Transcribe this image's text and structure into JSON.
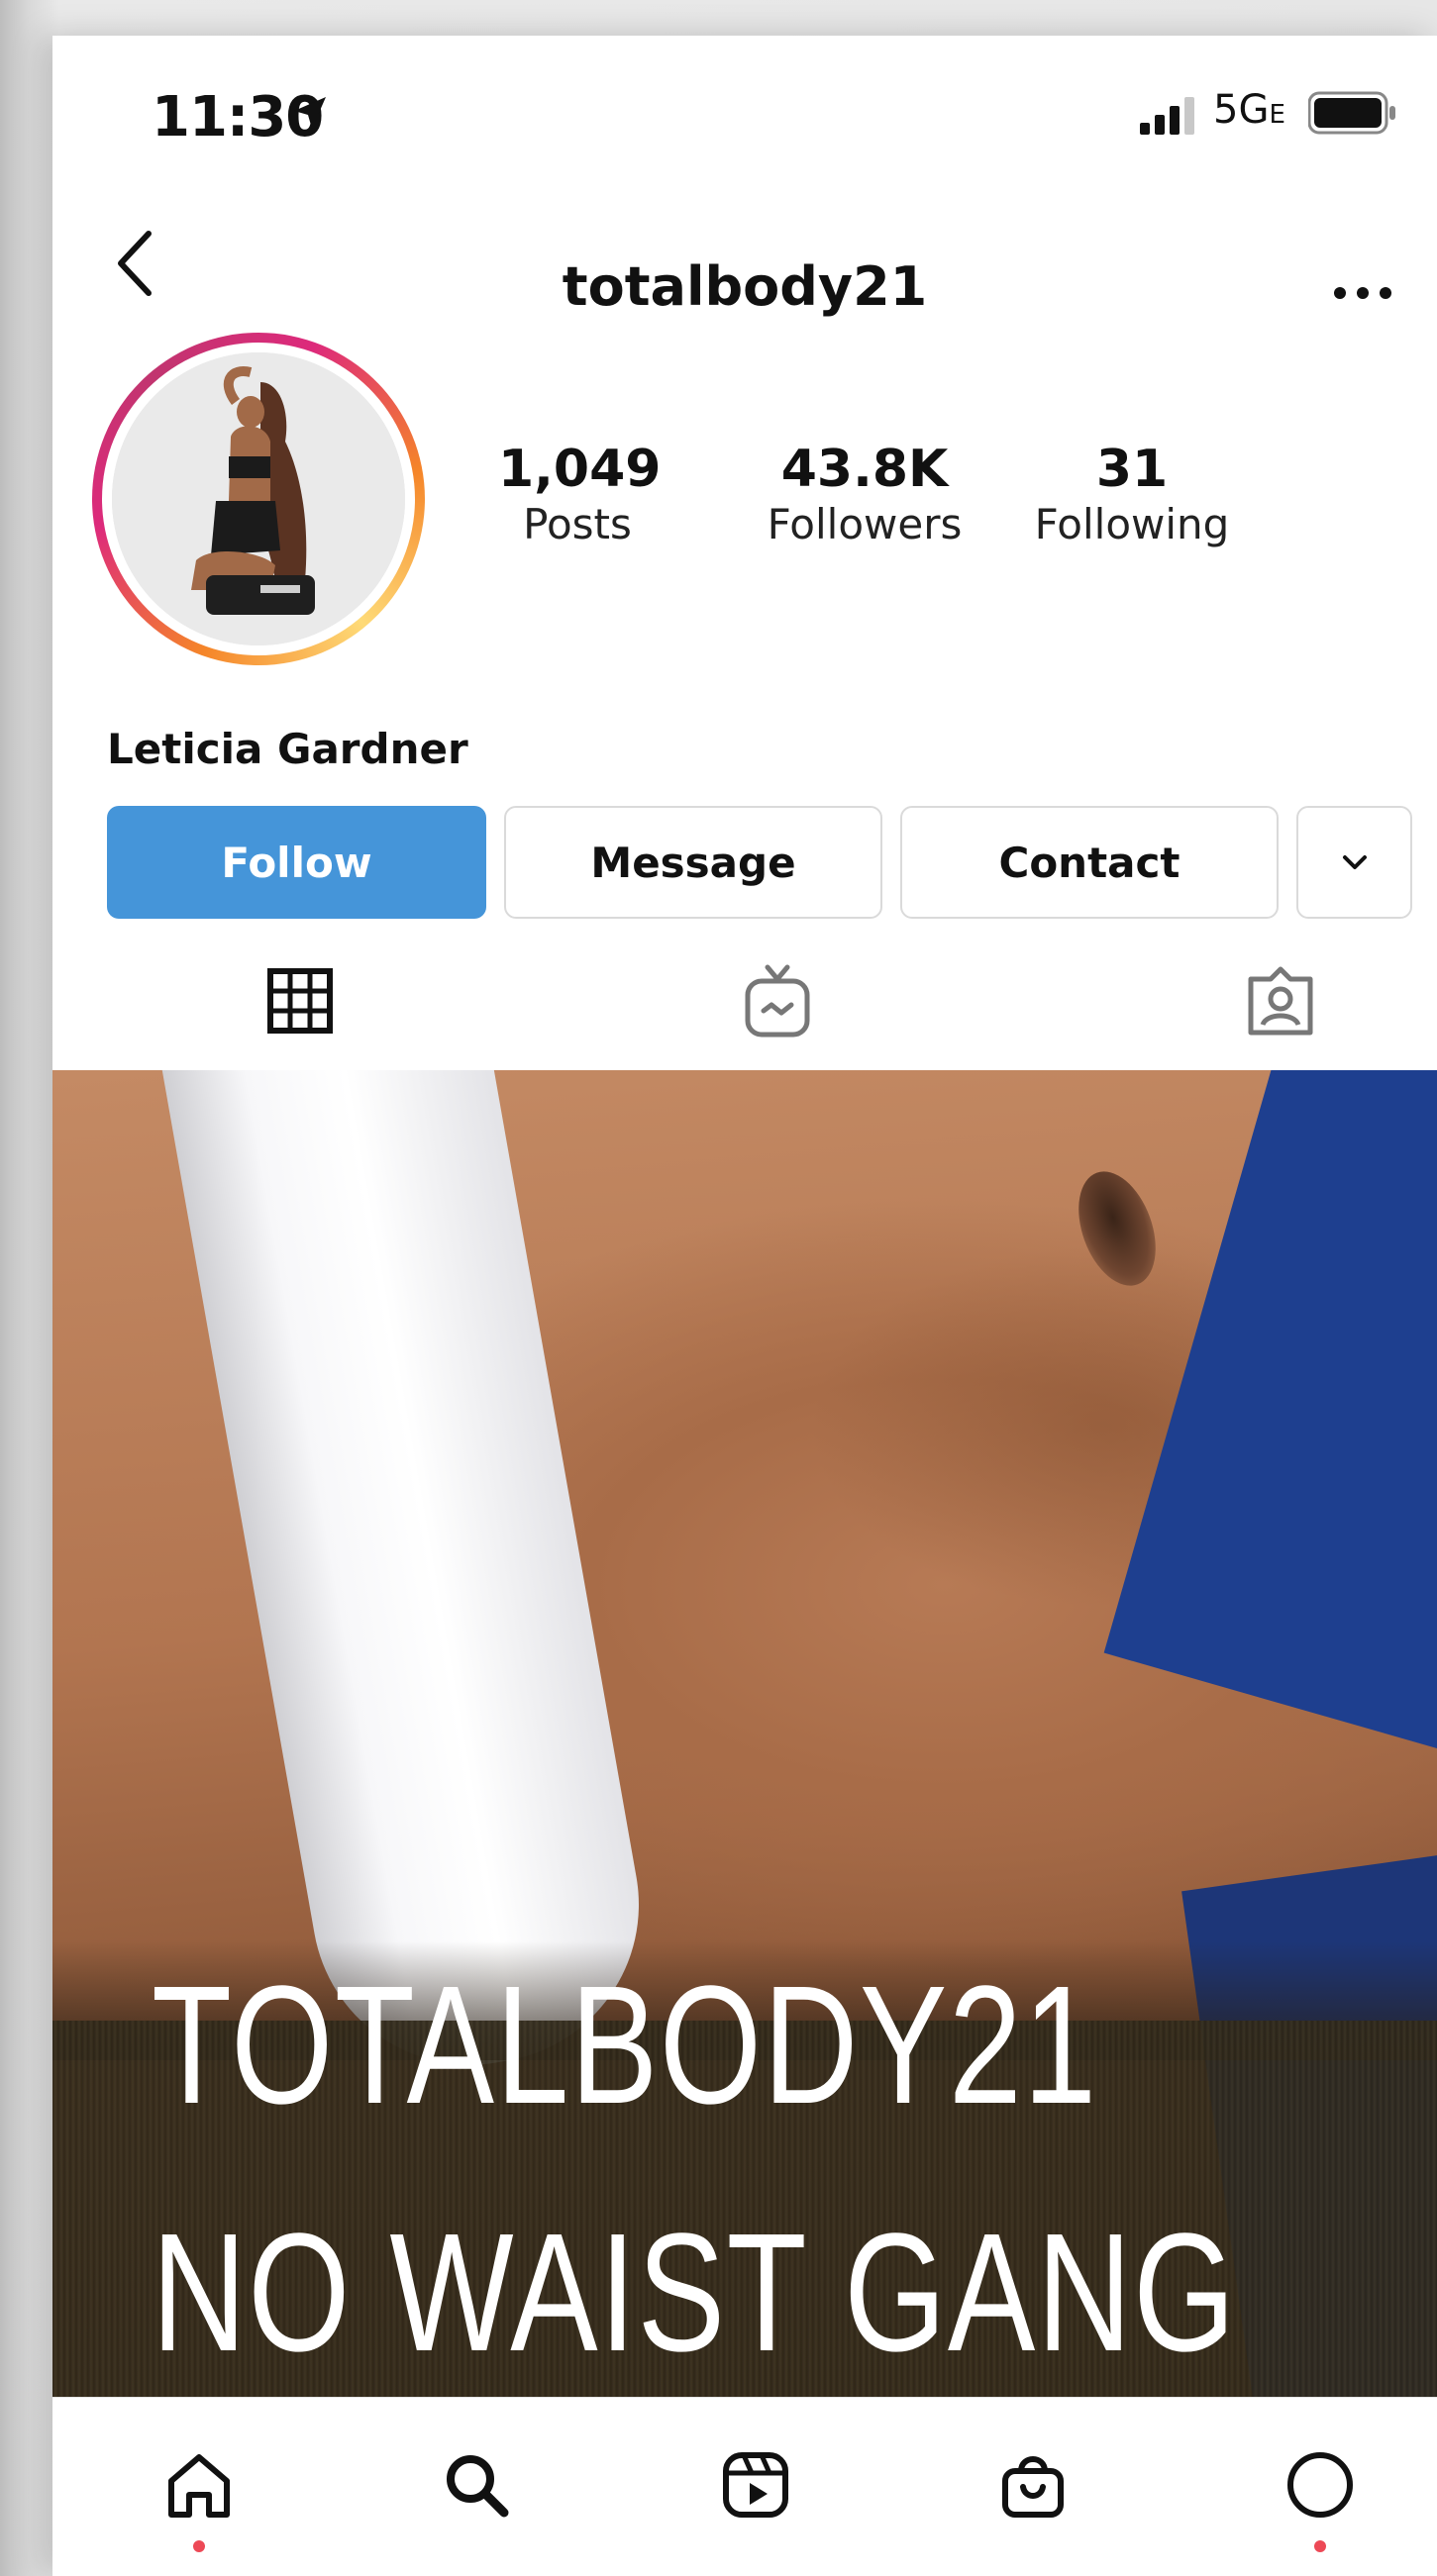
{
  "status_bar": {
    "time": "11:30",
    "network": "5G",
    "network_suffix": "E"
  },
  "header": {
    "username": "totalbody21"
  },
  "profile": {
    "display_name": "Leticia Gardner",
    "stats": [
      {
        "value": "1,049",
        "label": "Posts"
      },
      {
        "value": "43.8K",
        "label": "Followers"
      },
      {
        "value": "31",
        "label": "Following"
      }
    ]
  },
  "actions": {
    "follow": "Follow",
    "message": "Message",
    "contact": "Contact"
  },
  "post": {
    "line1": "TOTALBODY21",
    "line2": "NO WAIST GANG"
  },
  "colors": {
    "follow_button": "#4595d9",
    "notification_dot": "#ed4956"
  },
  "icons": {
    "tabs": [
      "grid-icon",
      "igtv-icon",
      "tagged-icon"
    ],
    "nav": [
      "home-icon",
      "search-icon",
      "reels-icon",
      "shop-icon",
      "profile-icon"
    ]
  }
}
